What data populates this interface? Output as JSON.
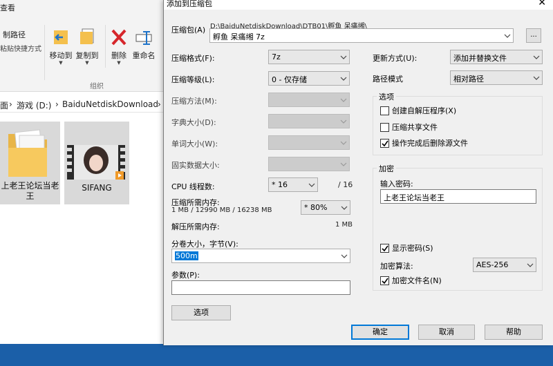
{
  "explorer": {
    "ribbon": {
      "tab_label": "查看",
      "copy_path": "制路径",
      "paste_shortcut": "粘贴快捷方式",
      "move_to": "移动到",
      "copy_to": "复制到",
      "delete": "删除",
      "rename": "重命名",
      "group_label": "组织"
    },
    "address": {
      "seg0": "面",
      "sep1": "›",
      "seg1": "游戏 (D:)",
      "sep2": "›",
      "seg2": "BaiduNetdiskDownload",
      "sep3": "›"
    },
    "items": [
      {
        "name": "上老王论坛当老王",
        "icon": "folder-icon"
      },
      {
        "name": "SIFANG",
        "icon": "video-thumbnail"
      }
    ]
  },
  "dialog": {
    "title": "添加到压缩包",
    "close": "✕",
    "archive": {
      "label": "压缩包(A)",
      "path": "D:\\BaiduNetdiskDownload\\DTB01\\孵鱼 呆痛缃\\",
      "name": "孵鱼 呆痛缃 7z",
      "browse": "..."
    },
    "format": {
      "label": "压缩格式(F):",
      "value": "7z"
    },
    "level": {
      "label": "压缩等级(L):",
      "value": "0 - 仅存储"
    },
    "method": {
      "label": "压缩方法(M):",
      "value": ""
    },
    "dict": {
      "label": "字典大小(D):",
      "value": ""
    },
    "word": {
      "label": "单词大小(W):",
      "value": ""
    },
    "solid": {
      "label": "固实数据大小:",
      "value": ""
    },
    "threads": {
      "label": "CPU 线程数:",
      "value": "* 16",
      "max": "/ 16"
    },
    "mem_compress": {
      "label": "压缩所需内存:",
      "detail": "1 MB / 12990 MB / 16238 MB",
      "value": "* 80%"
    },
    "mem_decompress": {
      "label": "解压所需内存:",
      "value": "1 MB"
    },
    "volume": {
      "label": "分卷大小，字节(V):",
      "value": "500m"
    },
    "params": {
      "label": "参数(P):",
      "value": ""
    },
    "update_mode": {
      "label": "更新方式(U):",
      "value": "添加并替换文件"
    },
    "path_mode": {
      "label": "路径模式",
      "value": "相对路径"
    },
    "options": {
      "title": "选项",
      "sfx": {
        "label": "创建自解压程序(X)",
        "checked": false
      },
      "shared": {
        "label": "压缩共享文件",
        "checked": false
      },
      "delete_after": {
        "label": "操作完成后删除源文件",
        "checked": true
      }
    },
    "encryption": {
      "title": "加密",
      "password_label": "输入密码:",
      "password": "上老王论坛当老王",
      "show_password": {
        "label": "显示密码(S)",
        "checked": true
      },
      "method_label": "加密算法:",
      "method": "AES-256",
      "encrypt_names": {
        "label": "加密文件名(N)",
        "checked": true
      }
    },
    "buttons": {
      "options": "选项",
      "ok": "确定",
      "cancel": "取消",
      "help": "帮助"
    }
  }
}
